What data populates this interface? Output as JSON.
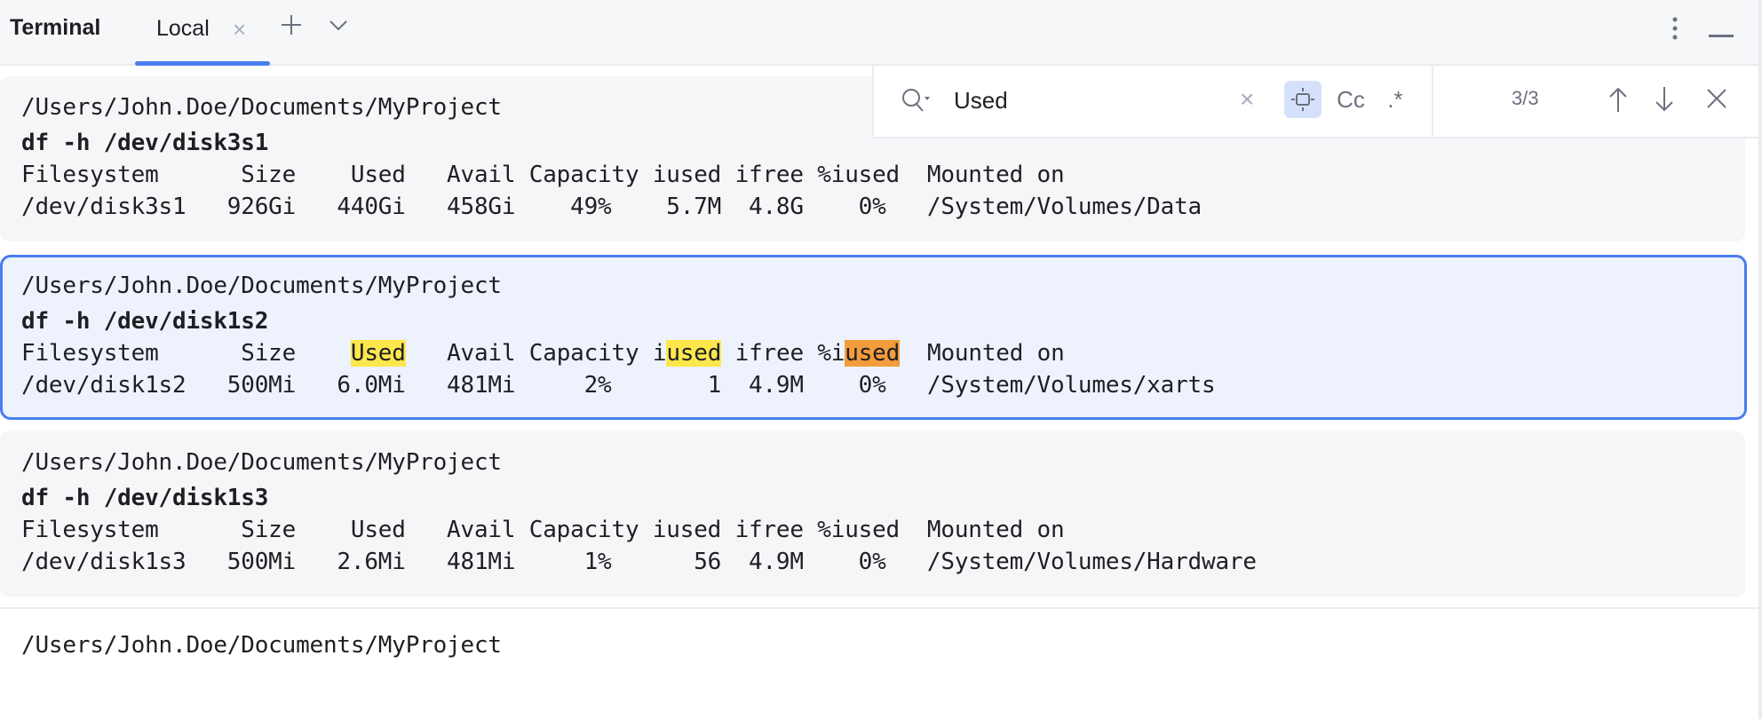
{
  "toolwindow": {
    "title": "Terminal",
    "tabs": [
      {
        "label": "Local",
        "active": true
      }
    ],
    "icons": {
      "close_tab": "close-icon",
      "new_tab": "plus-icon",
      "tab_menu": "chevron-down-icon",
      "options": "more-vertical-icon",
      "hide": "minimize-icon"
    }
  },
  "search": {
    "query": "Used",
    "placeholder": "",
    "match_count": "3/3",
    "options": {
      "words": "word-match-icon",
      "match_case": "Cc",
      "regex": ".*"
    },
    "words_enabled": true,
    "colors": {
      "match": "#fde74c",
      "current_match": "#f39c3c",
      "accent": "#4a7df0"
    }
  },
  "blocks": [
    {
      "cwd": "/Users/John.Doe/Documents/MyProject",
      "command": "df -h /dev/disk3s1",
      "header": "Filesystem      Size    Used   Avail Capacity iused ifree %iused  Mounted on",
      "row": "/dev/disk3s1   926Gi   440Gi   458Gi    49%    5.7M  4.8G    0%   /System/Volumes/Data",
      "selected": false
    },
    {
      "cwd": "/Users/John.Doe/Documents/MyProject",
      "command": "df -h /dev/disk1s2",
      "header_parts": [
        "Filesystem      Size    ",
        "Used",
        "   Avail Capacity i",
        "used",
        " ifree %i",
        "used",
        "  Mounted on"
      ],
      "row": "/dev/disk1s2   500Mi   6.0Mi   481Mi     2%       1  4.9M    0%   /System/Volumes/xarts",
      "selected": true
    },
    {
      "cwd": "/Users/John.Doe/Documents/MyProject",
      "command": "df -h /dev/disk1s3",
      "header": "Filesystem      Size    Used   Avail Capacity iused ifree %iused  Mounted on",
      "row": "/dev/disk1s3   500Mi   2.6Mi   481Mi     1%      56  4.9M    0%   /System/Volumes/Hardware",
      "selected": false
    }
  ],
  "prompt": {
    "cwd": "/Users/John.Doe/Documents/MyProject"
  }
}
